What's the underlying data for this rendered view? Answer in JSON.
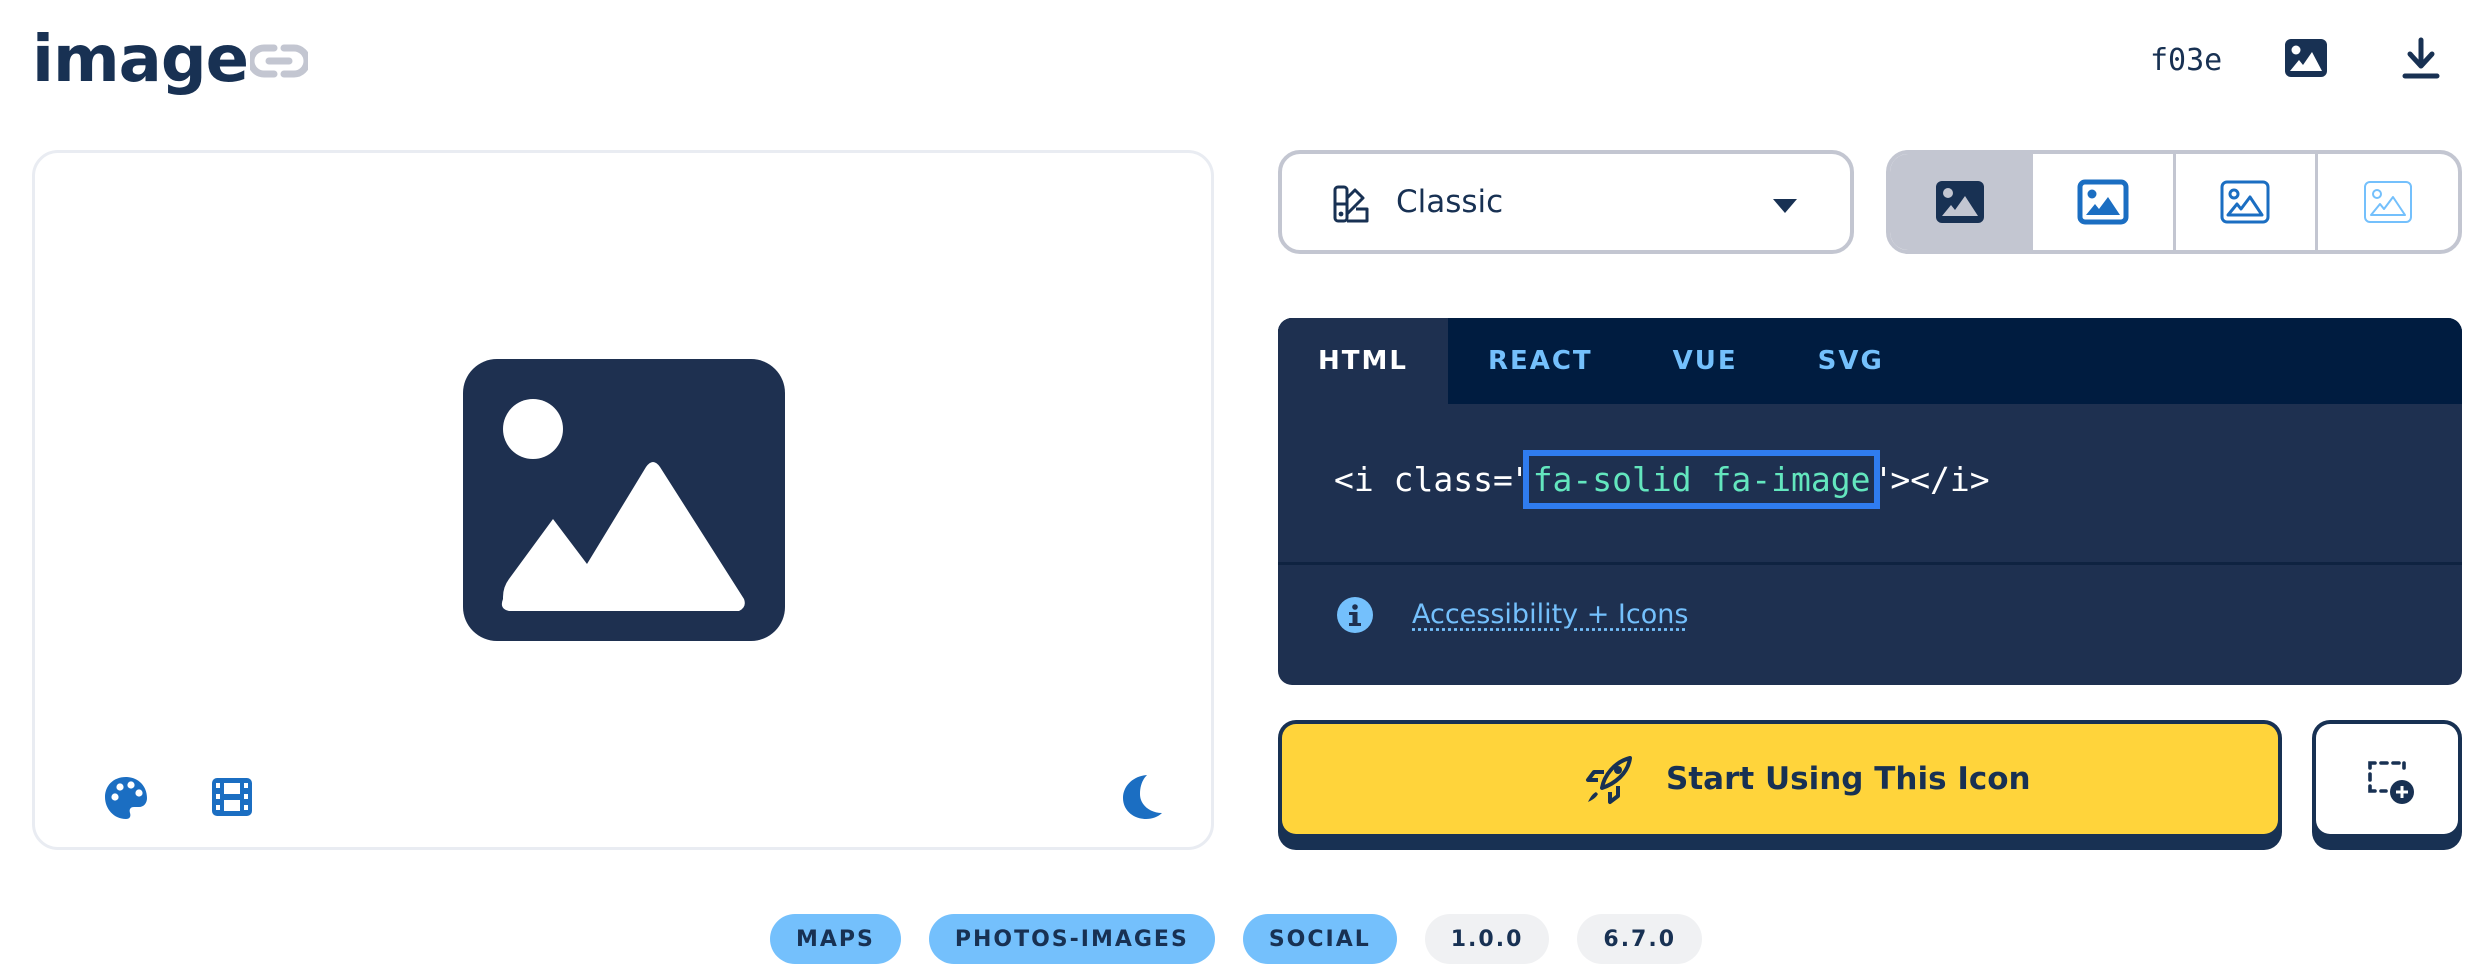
{
  "header": {
    "title": "image",
    "unicode": "f03e"
  },
  "icons": {
    "link": "link-icon",
    "header_image": "image-icon",
    "download": "download-icon",
    "palette": "palette-icon",
    "film": "film-icon",
    "moon": "moon-icon",
    "style": "swatchbook-icon",
    "caret": "caret-down-icon",
    "info": "circle-info-icon",
    "rocket": "rocket-icon",
    "add_to_kit": "square-dashed-circle-plus-icon"
  },
  "style_select": {
    "label": "Classic"
  },
  "variants": [
    "solid",
    "regular",
    "light",
    "thin"
  ],
  "code": {
    "tabs": [
      "HTML",
      "REACT",
      "VUE",
      "SVG"
    ],
    "active_tab": "HTML",
    "prefix": "<i class=\"",
    "class_name": "fa-solid fa-image",
    "suffix": "\"></i>",
    "a11y_link": "Accessibility + Icons"
  },
  "cta": {
    "start_label": "Start Using This Icon"
  },
  "tags": {
    "categories": [
      "MAPS",
      "PHOTOS-IMAGES",
      "SOCIAL"
    ],
    "versions": [
      "1.0.0",
      "6.7.0"
    ]
  },
  "colors": {
    "navy": "#183153",
    "yellow": "#ffd43b",
    "code_bg": "#1e3050",
    "tabs_bg": "#001c40",
    "accent_blue": "#74c0fc",
    "code_green": "#63e6be",
    "highlight": "#2f7cf0",
    "icon_blue": "#1b6ec2"
  }
}
